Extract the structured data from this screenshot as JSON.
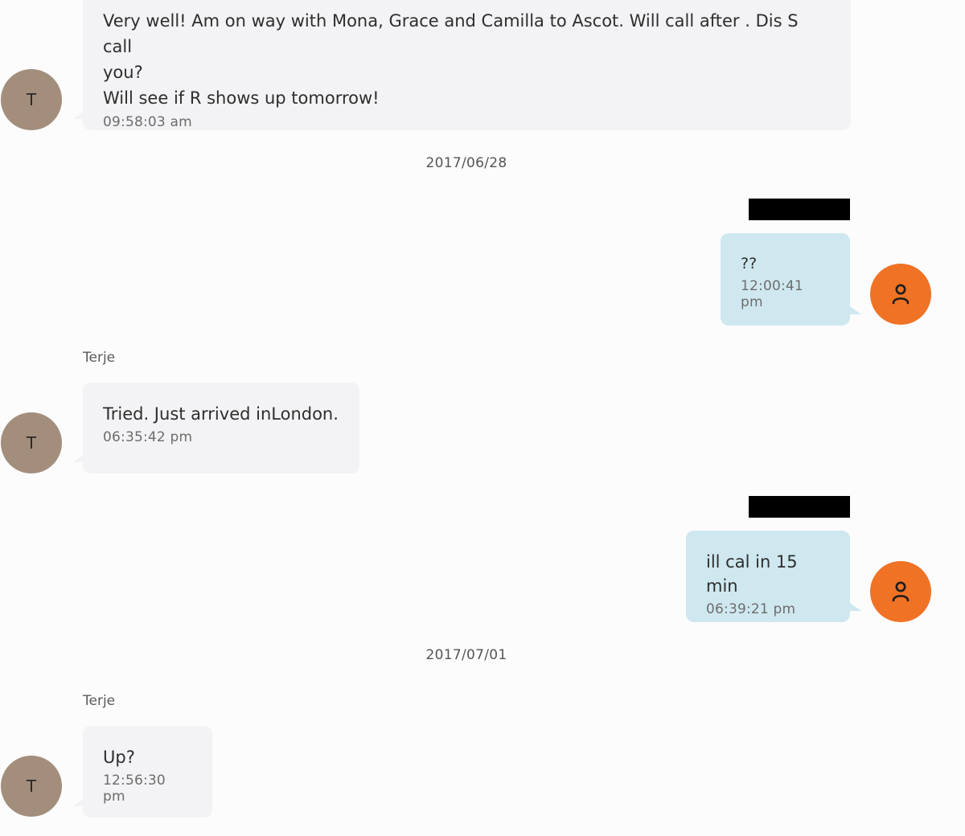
{
  "colors": {
    "incoming_bubble": "#f3f2f4",
    "outgoing_bubble": "#cfe8f0",
    "contact_avatar": "#a38e7c",
    "own_avatar": "#f07225",
    "redaction": "#000000"
  },
  "messages": [
    {
      "direction": "incoming",
      "text": "Very well! Am on way with Mona, Grace and Camilla to Ascot. Will call after . Dis S call\nyou?\nWill see if R shows up tomorrow!",
      "time": "09:58:03 am",
      "avatar_initial": "T"
    },
    {
      "direction": "outgoing",
      "text": "??",
      "time": "12:00:41 pm",
      "avatar_icon": "person-icon"
    },
    {
      "direction": "incoming",
      "sender": "Terje",
      "text": "Tried. Just arrived inLondon.",
      "time": "06:35:42 pm",
      "avatar_initial": "T"
    },
    {
      "direction": "outgoing",
      "text": "ill cal in 15 min",
      "time": "06:39:21 pm",
      "avatar_icon": "person-icon"
    },
    {
      "direction": "incoming",
      "sender": "Terje",
      "text": "Up?",
      "time": "12:56:30 pm",
      "avatar_initial": "T"
    }
  ],
  "date_separators": [
    "2017/06/28",
    "2017/07/01"
  ]
}
